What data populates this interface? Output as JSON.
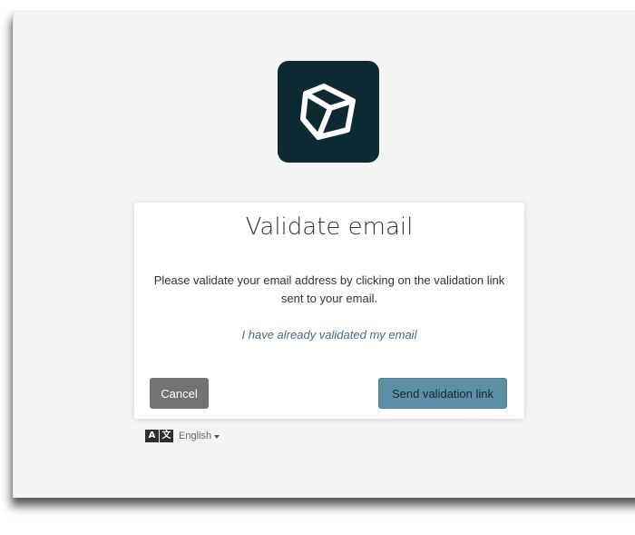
{
  "card": {
    "title": "Validate email",
    "message": "Please validate your email address by clicking on the validation link sent to your email.",
    "already_validated_link": "I have already validated my email",
    "cancel_label": "Cancel",
    "send_label": "Send validation link"
  },
  "language": {
    "icon_left": "A",
    "icon_right": "文",
    "selected": "English"
  },
  "colors": {
    "logo_bg": "#0d2a33",
    "primary_button": "#5d90a6",
    "secondary_button": "#737373",
    "link": "#4a6a7d"
  },
  "icons": {
    "logo": "cube-icon",
    "language": "translate-icon",
    "dropdown": "caret-down-icon"
  }
}
